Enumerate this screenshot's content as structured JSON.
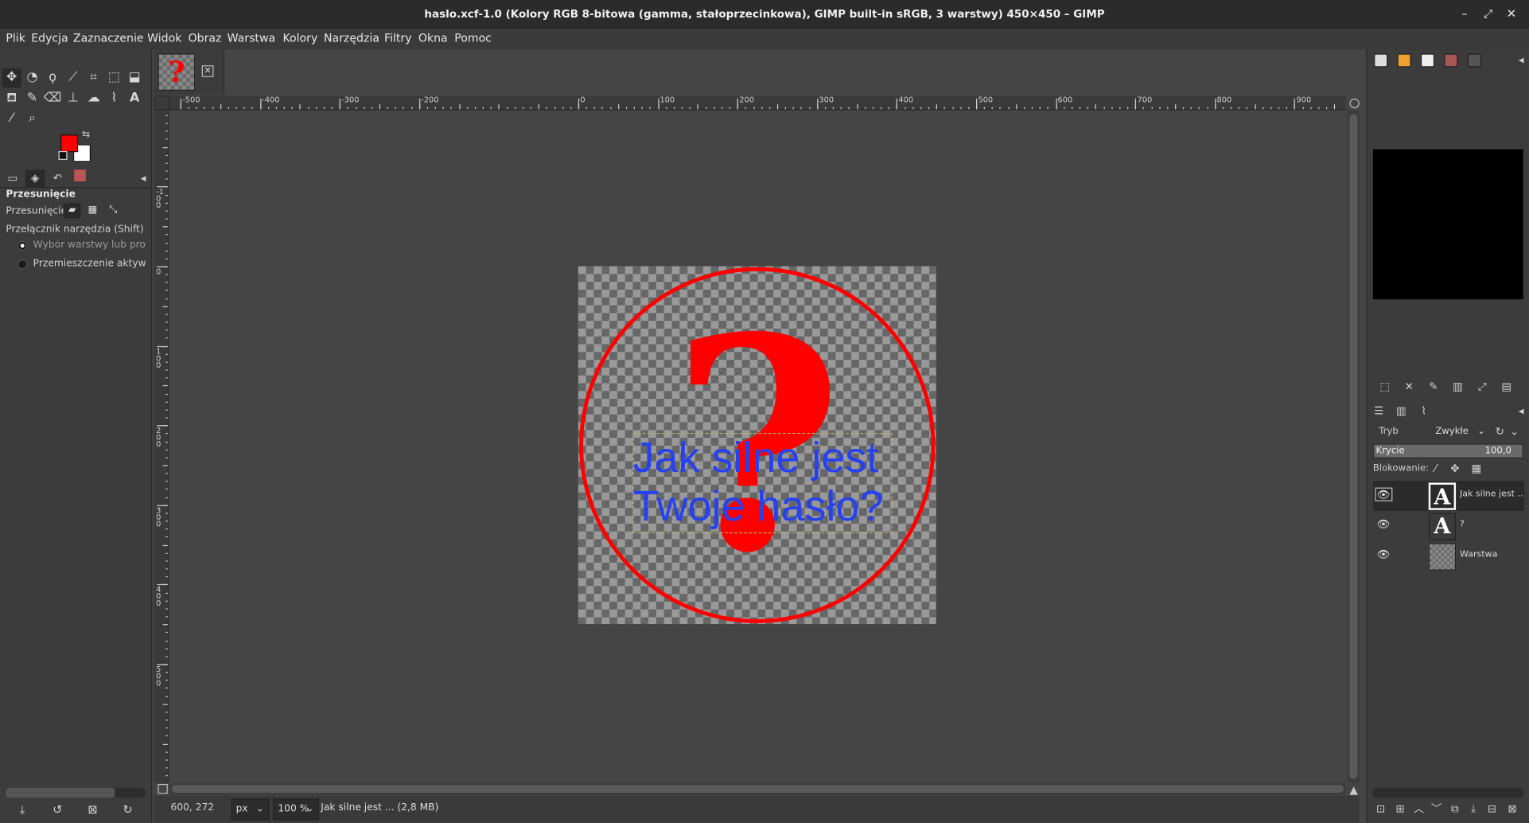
{
  "window": {
    "title": "haslo.xcf-1.0 (Kolory RGB 8-bitowa (gamma, stałoprzecinkowa), GIMP built-in sRGB, 3 warstwy) 450×450 – GIMP",
    "min_icon": "–",
    "max_icon": "⤢",
    "close_icon": "✕"
  },
  "menu": {
    "items": [
      "Plik",
      "Edycja",
      "Zaznaczenie",
      "Widok",
      "Obraz",
      "Warstwa",
      "Kolory",
      "Narzędzia",
      "Filtry",
      "Okna",
      "Pomoc"
    ]
  },
  "toolbox": {
    "tools": [
      {
        "name": "move-tool-icon",
        "glyph": "✥"
      },
      {
        "name": "ellipse-select-icon",
        "glyph": "◔"
      },
      {
        "name": "free-select-icon",
        "glyph": "ϙ"
      },
      {
        "name": "fuzzy-select-icon",
        "glyph": "⟋"
      },
      {
        "name": "crop-icon",
        "glyph": "⌗"
      },
      {
        "name": "transform-icon",
        "glyph": "⬚"
      },
      {
        "name": "warp-icon",
        "glyph": "⬓"
      },
      {
        "name": "bucket-fill-icon",
        "glyph": "⛾"
      },
      {
        "name": "paintbrush-icon",
        "glyph": "✎"
      },
      {
        "name": "eraser-icon",
        "glyph": "⌫"
      },
      {
        "name": "clone-icon",
        "glyph": "⊥"
      },
      {
        "name": "smudge-icon",
        "glyph": "☁"
      },
      {
        "name": "paths-icon",
        "glyph": "⌇"
      },
      {
        "name": "text-tool-icon",
        "glyph": "A"
      },
      {
        "name": "color-picker-icon",
        "glyph": "⁄"
      },
      {
        "name": "zoom-tool-icon",
        "glyph": "⌕"
      }
    ],
    "fg_color": "#ff0000",
    "bg_color": "#ffffff"
  },
  "tool_options": {
    "title": "Przesunięcie",
    "move_label": "Przesunięcie:",
    "switch_label": "Przełącznik narzędzia  (Shift)",
    "radio1": "Wybór warstwy lub prowadnicy",
    "radio2": "Przemieszczenie aktywnej warstwy"
  },
  "rulers": {
    "h_labels": [
      "-500",
      "-400",
      "-300",
      "-200",
      "0",
      "100",
      "200",
      "300",
      "400",
      "500",
      "600",
      "700",
      "800",
      "900"
    ],
    "v_labels": [
      "-100",
      "0",
      "100",
      "200",
      "300",
      "400",
      "500"
    ]
  },
  "canvas": {
    "question_mark": "?",
    "text_line1": "Jak silne jest",
    "text_line2": "Twoje hasło?"
  },
  "status": {
    "coords": "600, 272",
    "unit": "px",
    "zoom": "100 %",
    "message": "Jak silne jest ... (2,8 MB)"
  },
  "layers_panel": {
    "mode_label": "Tryb",
    "mode_value": "Zwykłe",
    "opacity_label": "Krycie",
    "opacity_value": "100,0",
    "lock_label": "Blokowanie:",
    "layers": [
      {
        "name": "Jak silne jest ...",
        "thumb": "A",
        "selected": true
      },
      {
        "name": "?",
        "thumb": "A",
        "selected": false
      },
      {
        "name": "Warstwa",
        "thumb": "",
        "selected": false
      }
    ]
  }
}
